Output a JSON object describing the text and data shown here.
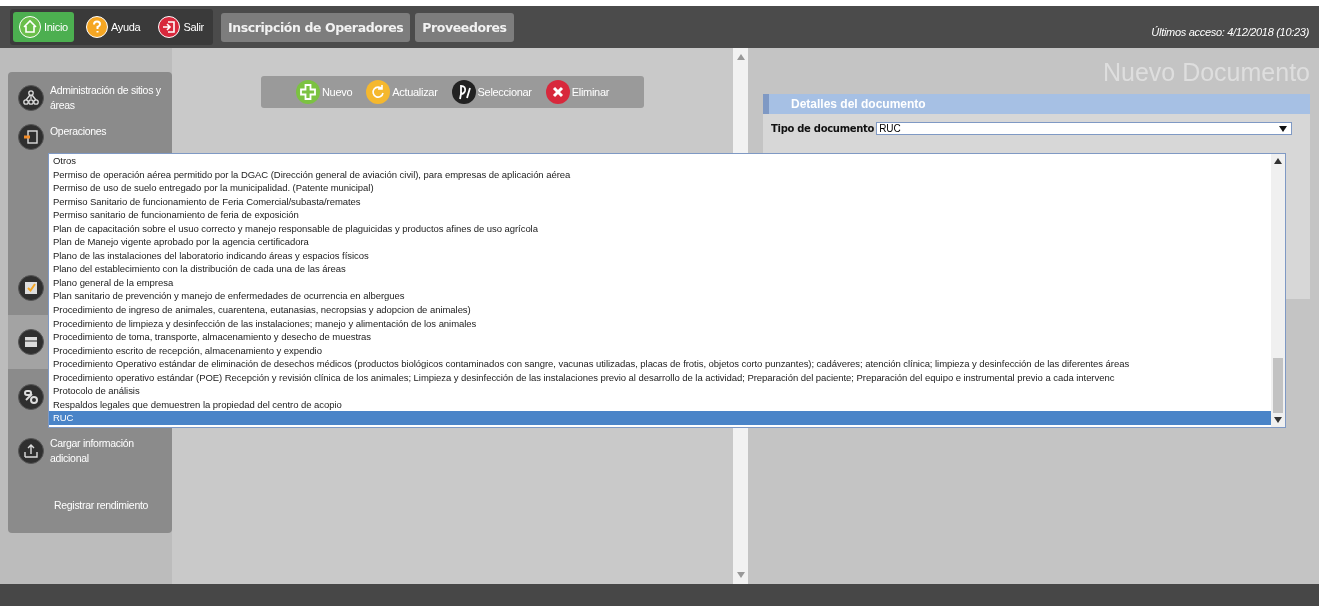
{
  "top_bar": {
    "nav_buttons": [
      {
        "label": "Inicio",
        "kind": "home",
        "selected": true
      },
      {
        "label": "Ayuda",
        "kind": "help",
        "selected": false
      },
      {
        "label": "Salir",
        "kind": "exit",
        "selected": false
      }
    ],
    "tabs": [
      {
        "label": "Inscripción de Operadores"
      },
      {
        "label": "Proveedores"
      }
    ],
    "last_access": "Últimos acceso: 4/12/2018 (10:23)"
  },
  "sidebar": {
    "items": [
      {
        "label": "Administración de sitios y áreas",
        "kind": "sites",
        "selected": false
      },
      {
        "label": "Operaciones",
        "kind": "operations",
        "selected": false
      },
      {
        "kind": "approve",
        "selected": false
      },
      {
        "kind": "documents",
        "selected": true
      },
      {
        "kind": "link",
        "selected": false
      },
      {
        "label": "Cargar información adicional",
        "kind": "upload",
        "selected": false
      },
      {
        "label": "Registrar rendimiento",
        "kind": "none",
        "selected": false
      }
    ]
  },
  "toolbar": [
    {
      "label": "Nuevo",
      "kind": "new"
    },
    {
      "label": "Actualizar",
      "kind": "refresh"
    },
    {
      "label": "Seleccionar",
      "kind": "select"
    },
    {
      "label": "Eliminar",
      "kind": "delete"
    }
  ],
  "panel": {
    "title": "Nuevo Documento",
    "section": "Detalles del documento",
    "document_type": {
      "label": "Tipo de documento",
      "value": "RUC"
    }
  },
  "dropdown": {
    "options": [
      {
        "label": "Otros",
        "selected": false
      },
      {
        "label": "Permiso de operación aérea permitido por la DGAC (Dirección general de aviación civil), para empresas de aplicación aérea",
        "selected": false
      },
      {
        "label": "Permiso de uso de suelo entregado por la municipalidad. (Patente municipal)",
        "selected": false
      },
      {
        "label": "Permiso Sanitario de funcionamiento de Feria Comercial/subasta/remates",
        "selected": false
      },
      {
        "label": "Permiso sanitario de funcionamiento de feria de exposición",
        "selected": false
      },
      {
        "label": "Plan de capacitación sobre el usuo correcto y manejo responsable de plaguicidas y productos afines de uso agrícola",
        "selected": false
      },
      {
        "label": "Plan de Manejo vigente aprobado por la agencia certificadora",
        "selected": false
      },
      {
        "label": "Plano de las instalaciones del laboratorio indicando áreas y espacios físicos",
        "selected": false
      },
      {
        "label": "Plano del establecimiento con la distribución de cada una de las áreas",
        "selected": false
      },
      {
        "label": "Plano general de la empresa",
        "selected": false
      },
      {
        "label": "Plan sanitario de prevención y manejo de enfermedades de ocurrencia en albergues",
        "selected": false
      },
      {
        "label": "Procedimiento de ingreso de animales, cuarentena, eutanasias, necropsias y adopcion de animales)",
        "selected": false
      },
      {
        "label": "Procedimiento de limpieza y desinfección de las instalaciones; manejo y alimentación de los animales",
        "selected": false
      },
      {
        "label": "Procedimiento de toma, transporte, almacenamiento y desecho de muestras",
        "selected": false
      },
      {
        "label": "Procedimiento escrito de recepción, almacenamiento y expendio",
        "selected": false
      },
      {
        "label": "Procedimiento Operativo estándar de eliminación de desechos médicos (productos biológicos contaminados con sangre, vacunas utilizadas, placas de frotis, objetos corto punzantes); cadáveres; atención clínica; limpieza y desinfección de las diferentes áreas",
        "selected": false
      },
      {
        "label": "Procedimiento operativo estándar (POE) Recepción y revisión clínica de los animales; Limpieza y desinfección de las instalaciones previo al desarrollo de la actividad; Preparación del paciente; Preparación del equipo e instrumental previo a cada intervenc",
        "selected": false
      },
      {
        "label": "Protocolo de análisis",
        "selected": false
      },
      {
        "label": "Respaldos legales que demuestren la propiedad del centro de acopio",
        "selected": false
      },
      {
        "label": "RUC",
        "selected": true
      }
    ]
  }
}
